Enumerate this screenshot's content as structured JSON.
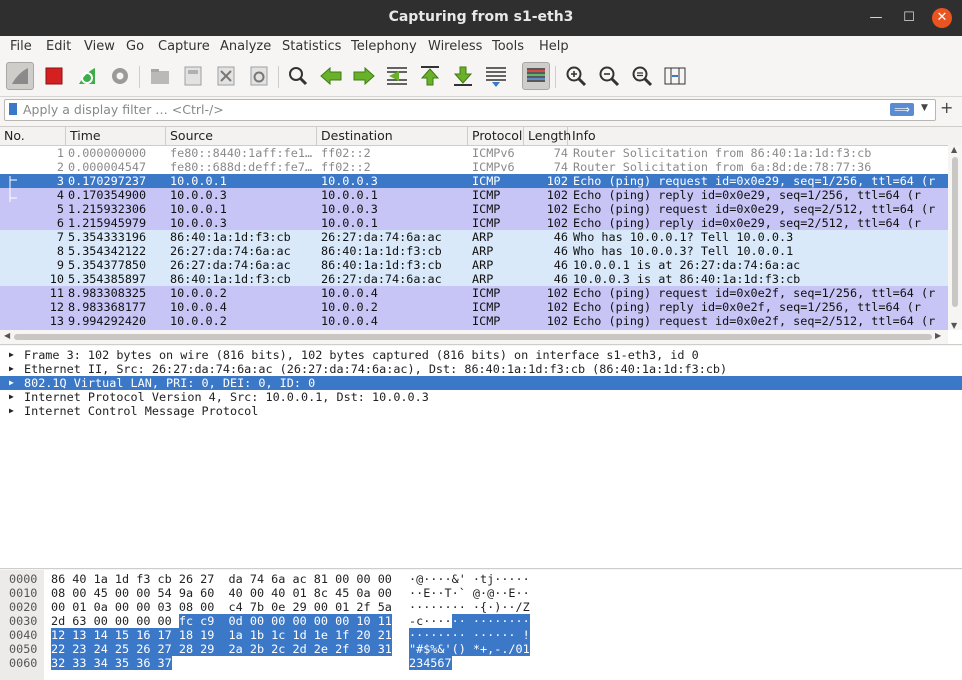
{
  "window": {
    "title": "Capturing from s1-eth3",
    "minimize_glyph": "—",
    "maximize_glyph": "☐",
    "close_glyph": "✕"
  },
  "menu": [
    "File",
    "Edit",
    "View",
    "Go",
    "Capture",
    "Analyze",
    "Statistics",
    "Telephony",
    "Wireless",
    "Tools",
    "Help"
  ],
  "toolbar": {
    "icons": [
      "shark-fin-start-icon",
      "stop-capture-icon",
      "restart-capture-icon",
      "capture-options-icon",
      "open-file-icon",
      "save-file-icon",
      "close-file-icon",
      "reload-file-icon",
      "find-packet-icon",
      "go-back-icon",
      "go-forward-icon",
      "go-to-packet-icon",
      "first-packet-icon",
      "last-packet-icon",
      "autoscroll-icon",
      "colorize-icon",
      "zoom-in-icon",
      "zoom-out-icon",
      "normal-size-icon",
      "resize-columns-icon"
    ]
  },
  "filter": {
    "placeholder": "Apply a display filter … <Ctrl-/>",
    "apply_glyph": "⟹",
    "dropdown_glyph": "▼",
    "add_glyph": "+"
  },
  "packet_list": {
    "columns": [
      "No.",
      "Time",
      "Source",
      "Destination",
      "Protocol",
      "Length",
      "Info"
    ],
    "rows": [
      {
        "no": "1",
        "time": "0.000000000",
        "src": "fe80::8440:1aff:fe1…",
        "dst": "ff02::2",
        "proto": "ICMPv6",
        "len": "74",
        "info": "Router Solicitation from 86:40:1a:1d:f3:cb",
        "style": "ipv6"
      },
      {
        "no": "2",
        "time": "0.000004547",
        "src": "fe80::688d:deff:fe7…",
        "dst": "ff02::2",
        "proto": "ICMPv6",
        "len": "74",
        "info": "Router Solicitation from 6a:8d:de:78:77:36",
        "style": "ipv6"
      },
      {
        "no": "3",
        "time": "0.170297237",
        "src": "10.0.0.1",
        "dst": "10.0.0.3",
        "proto": "ICMP",
        "len": "102",
        "info": "Echo (ping) request  id=0x0e29, seq=1/256, ttl=64 (r",
        "style": "selected"
      },
      {
        "no": "4",
        "time": "0.170354900",
        "src": "10.0.0.3",
        "dst": "10.0.0.1",
        "proto": "ICMP",
        "len": "102",
        "info": "Echo (ping) reply    id=0x0e29, seq=1/256, ttl=64 (r",
        "style": "icmp"
      },
      {
        "no": "5",
        "time": "1.215932306",
        "src": "10.0.0.1",
        "dst": "10.0.0.3",
        "proto": "ICMP",
        "len": "102",
        "info": "Echo (ping) request  id=0x0e29, seq=2/512, ttl=64 (r",
        "style": "icmp"
      },
      {
        "no": "6",
        "time": "1.215945979",
        "src": "10.0.0.3",
        "dst": "10.0.0.1",
        "proto": "ICMP",
        "len": "102",
        "info": "Echo (ping) reply    id=0x0e29, seq=2/512, ttl=64 (r",
        "style": "icmp"
      },
      {
        "no": "7",
        "time": "5.354333196",
        "src": "86:40:1a:1d:f3:cb",
        "dst": "26:27:da:74:6a:ac",
        "proto": "ARP",
        "len": "46",
        "info": "Who has 10.0.0.1? Tell 10.0.0.3",
        "style": "arp"
      },
      {
        "no": "8",
        "time": "5.354342122",
        "src": "26:27:da:74:6a:ac",
        "dst": "86:40:1a:1d:f3:cb",
        "proto": "ARP",
        "len": "46",
        "info": "Who has 10.0.0.3? Tell 10.0.0.1",
        "style": "arp"
      },
      {
        "no": "9",
        "time": "5.354377850",
        "src": "26:27:da:74:6a:ac",
        "dst": "86:40:1a:1d:f3:cb",
        "proto": "ARP",
        "len": "46",
        "info": "10.0.0.1 is at 26:27:da:74:6a:ac",
        "style": "arp"
      },
      {
        "no": "10",
        "time": "5.354385897",
        "src": "86:40:1a:1d:f3:cb",
        "dst": "26:27:da:74:6a:ac",
        "proto": "ARP",
        "len": "46",
        "info": "10.0.0.3 is at 86:40:1a:1d:f3:cb",
        "style": "arp"
      },
      {
        "no": "11",
        "time": "8.983308325",
        "src": "10.0.0.2",
        "dst": "10.0.0.4",
        "proto": "ICMP",
        "len": "102",
        "info": "Echo (ping) request  id=0x0e2f, seq=1/256, ttl=64 (r",
        "style": "icmp"
      },
      {
        "no": "12",
        "time": "8.983368177",
        "src": "10.0.0.4",
        "dst": "10.0.0.2",
        "proto": "ICMP",
        "len": "102",
        "info": "Echo (ping) reply    id=0x0e2f, seq=1/256, ttl=64 (r",
        "style": "icmp"
      },
      {
        "no": "13",
        "time": "9.994292420",
        "src": "10.0.0.2",
        "dst": "10.0.0.4",
        "proto": "ICMP",
        "len": "102",
        "info": "Echo (ping) request  id=0x0e2f, seq=2/512, ttl=64 (r",
        "style": "icmp"
      },
      {
        "no": "14",
        "time": "9.994327021",
        "src": "10.0.0.4",
        "dst": "10.0.0.2",
        "proto": "ICMP",
        "len": "102",
        "info": "Echo (ping) reply    id=0x0e2f, seq=2/512, ttl=64 (r",
        "style": "icmp"
      }
    ]
  },
  "details": {
    "rows": [
      {
        "text": "Frame 3: 102 bytes on wire (816 bits), 102 bytes captured (816 bits) on interface s1-eth3, id 0",
        "selected": false
      },
      {
        "text": "Ethernet II, Src: 26:27:da:74:6a:ac (26:27:da:74:6a:ac), Dst: 86:40:1a:1d:f3:cb (86:40:1a:1d:f3:cb)",
        "selected": false
      },
      {
        "text": "802.1Q Virtual LAN, PRI: 0, DEI: 0, ID: 0",
        "selected": true
      },
      {
        "text": "Internet Protocol Version 4, Src: 10.0.0.1, Dst: 10.0.0.3",
        "selected": false
      },
      {
        "text": "Internet Control Message Protocol",
        "selected": false
      }
    ],
    "expander_glyph": "▶"
  },
  "hex": {
    "rows": [
      {
        "offset": "0000",
        "bytes_plain": "86 40 1a 1d f3 cb 26 27  da 74 6a ac 81 00 00 00",
        "bytes_hl": "",
        "ascii_plain": "·@····&' ·tj·····",
        "ascii_hl": ""
      },
      {
        "offset": "0010",
        "bytes_plain": "08 00 45 00 00 54 9a 60  40 00 40 01 8c 45 0a 00",
        "bytes_hl": "",
        "ascii_plain": "··E··T·` @·@··E··",
        "ascii_hl": ""
      },
      {
        "offset": "0020",
        "bytes_plain": "00 01 0a 00 00 03 08 00  c4 7b 0e 29 00 01 2f 5a",
        "bytes_hl": "",
        "ascii_plain": "········ ·{·)··/Z",
        "ascii_hl": ""
      },
      {
        "offset": "0030",
        "bytes_plain": "2d 63 00 00 00 00 ",
        "bytes_hl": "fc c9  0d 00 00 00 00 00 10 11",
        "ascii_plain": "-c····",
        "ascii_hl": "·· ········"
      },
      {
        "offset": "0040",
        "bytes_plain": "",
        "bytes_hl": "12 13 14 15 16 17 18 19  1a 1b 1c 1d 1e 1f 20 21",
        "ascii_plain": "",
        "ascii_hl": "········ ······ !"
      },
      {
        "offset": "0050",
        "bytes_plain": "",
        "bytes_hl": "22 23 24 25 26 27 28 29  2a 2b 2c 2d 2e 2f 30 31",
        "ascii_plain": "",
        "ascii_hl": "\"#$%&'() *+,-./01"
      },
      {
        "offset": "0060",
        "bytes_plain": "",
        "bytes_hl": "32 33 34 35 36 37",
        "ascii_plain": "",
        "ascii_hl": "234567"
      }
    ]
  },
  "colors": {
    "selected_bg": "#3c78c8",
    "selected_fg": "#ffffff",
    "icmp_bg": "#c7c5f5",
    "arp_bg": "#d9e9fa",
    "ipv6_bg": "#ffffff",
    "ipv6_fg": "#8a8a8a",
    "titlebar_bg": "#2f2f2f",
    "stop_red": "#d42020",
    "fin_green": "#3fae49"
  }
}
